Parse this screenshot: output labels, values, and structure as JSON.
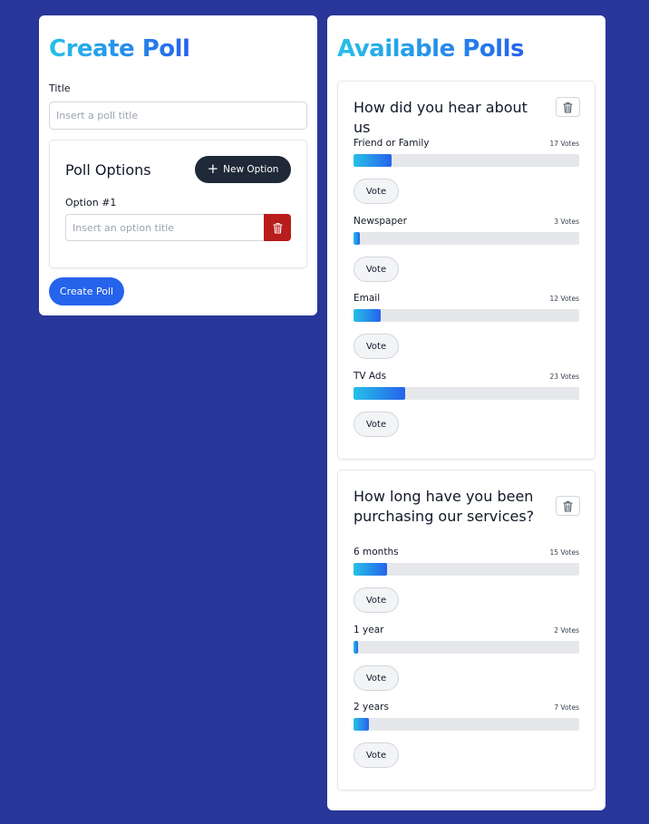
{
  "create_poll": {
    "heading": "Create Poll",
    "title_label": "Title",
    "title_placeholder": "Insert a poll title",
    "title_value": "",
    "options_heading": "Poll Options",
    "new_option_label": "New Option",
    "option_label": "Option #1",
    "option_placeholder": "Insert an option title",
    "option_value": "",
    "create_button_label": "Create Poll"
  },
  "available_polls": {
    "heading": "Available Polls",
    "vote_label": "Vote",
    "polls": [
      {
        "question": "How did you hear about us",
        "options": [
          {
            "label": "Friend or Family",
            "votes_text": "17 Votes",
            "share": 0.17
          },
          {
            "label": "Newspaper",
            "votes_text": "3 Votes",
            "share": 0.03
          },
          {
            "label": "Email",
            "votes_text": "12 Votes",
            "share": 0.12
          },
          {
            "label": "TV Ads",
            "votes_text": "23 Votes",
            "share": 0.23
          }
        ]
      },
      {
        "question": "How long have you been purchasing our services?",
        "options": [
          {
            "label": "6 months",
            "votes_text": "15 Votes",
            "share": 0.15
          },
          {
            "label": "1 year",
            "votes_text": "2 Votes",
            "share": 0.02
          },
          {
            "label": "2 years",
            "votes_text": "7 Votes",
            "share": 0.07
          }
        ]
      }
    ]
  },
  "colors": {
    "background": "#29369a",
    "accent": "#2563eb",
    "gradient_start": "#27c0e8",
    "danger": "#b91c1c",
    "dark_button": "#1f2937"
  },
  "icons": {
    "new_option": "plus-icon",
    "delete": "trash-icon"
  }
}
